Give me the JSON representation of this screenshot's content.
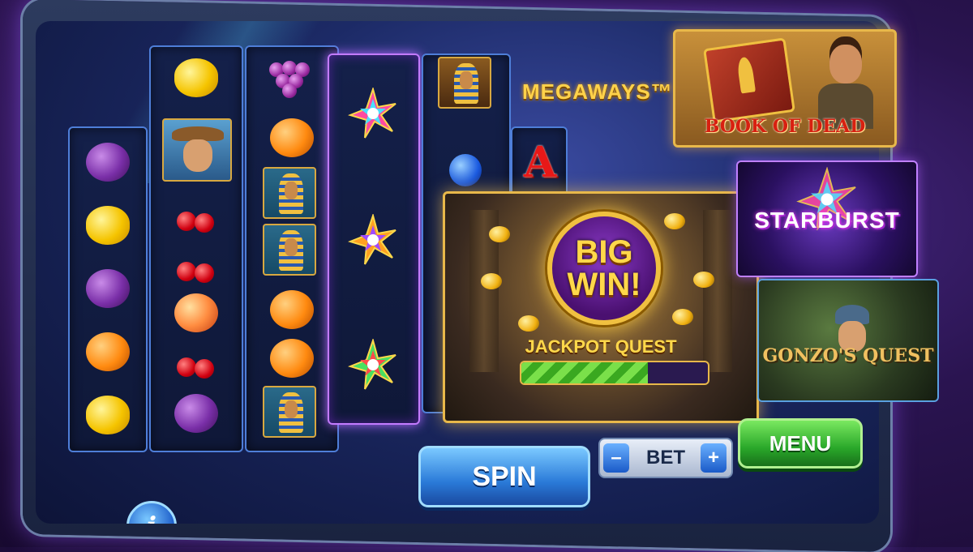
{
  "game": {
    "brand_label": "MEGAWAYS™"
  },
  "reels": [
    {
      "symbols": [
        "plum",
        "lemon",
        "plum",
        "orange",
        "lemon"
      ]
    },
    {
      "symbols": [
        "lemon",
        "explorer",
        "cherries",
        "cherries",
        "peach",
        "cherries",
        "plum"
      ]
    },
    {
      "symbols": [
        "grapes",
        "orange",
        "pharaoh",
        "pharaoh",
        "orange",
        "orange",
        "pharaoh"
      ]
    },
    {
      "symbols": [
        "starburst-gem",
        "starburst-gem",
        "starburst-gem"
      ],
      "highlighted": true
    },
    {
      "symbols": [
        "pharaoh-mask",
        "blueberries",
        "letter-a"
      ]
    }
  ],
  "big_win": {
    "line1": "BIG",
    "line2": "WIN!",
    "subtitle": "JACKPOT QUEST",
    "progress": 0.68
  },
  "promos": [
    {
      "title": "BOOK OF DEAD"
    },
    {
      "title": "STARBURST"
    },
    {
      "title": "GONZO'S QUEST"
    }
  ],
  "controls": {
    "spin_label": "SPIN",
    "bet_minus": "–",
    "bet_label": "BET",
    "bet_plus": "+",
    "menu_label": "MENU",
    "info_label": "i"
  },
  "colors": {
    "accent_gold": "#ffd24a",
    "spin_blue": "#2a7ad8",
    "menu_green": "#2aa82a",
    "highlight_purple": "#c37bff"
  }
}
